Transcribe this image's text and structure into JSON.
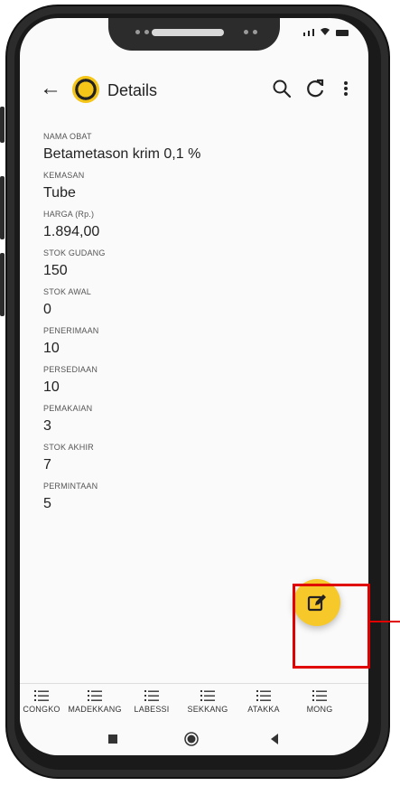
{
  "appbar": {
    "back_icon": "arrow-left-icon",
    "title": "Details",
    "icons": [
      "search-icon",
      "refresh-icon",
      "more-vertical-icon"
    ]
  },
  "fields": [
    {
      "label": "NAMA OBAT",
      "value": "Betametason krim 0,1 %"
    },
    {
      "label": "KEMASAN",
      "value": "Tube"
    },
    {
      "label": "HARGA (Rp.)",
      "value": "1.894,00"
    },
    {
      "label": "STOK GUDANG",
      "value": "150"
    },
    {
      "label": "STOK AWAL",
      "value": "0"
    },
    {
      "label": "PENERIMAAN",
      "value": "10"
    },
    {
      "label": "PERSEDIAAN",
      "value": "10"
    },
    {
      "label": "PEMAKAIAN",
      "value": "3"
    },
    {
      "label": "STOK AKHIR",
      "value": "7"
    },
    {
      "label": "PERMINTAAN",
      "value": "5"
    }
  ],
  "fab": {
    "icon": "edit-icon",
    "color": "#f7c82a"
  },
  "bottom_nav": [
    {
      "label": "CONGKO",
      "icon": "list-icon"
    },
    {
      "label": "MADEKKANG",
      "icon": "list-icon"
    },
    {
      "label": "LABESSI",
      "icon": "list-icon"
    },
    {
      "label": "SEKKANG",
      "icon": "list-icon"
    },
    {
      "label": "ATAKKA",
      "icon": "list-icon"
    },
    {
      "label": "MONG",
      "icon": "list-icon"
    }
  ],
  "system_nav": [
    "square-icon",
    "circle-icon",
    "back-triangle-icon"
  ],
  "highlight_color": "#e00000"
}
